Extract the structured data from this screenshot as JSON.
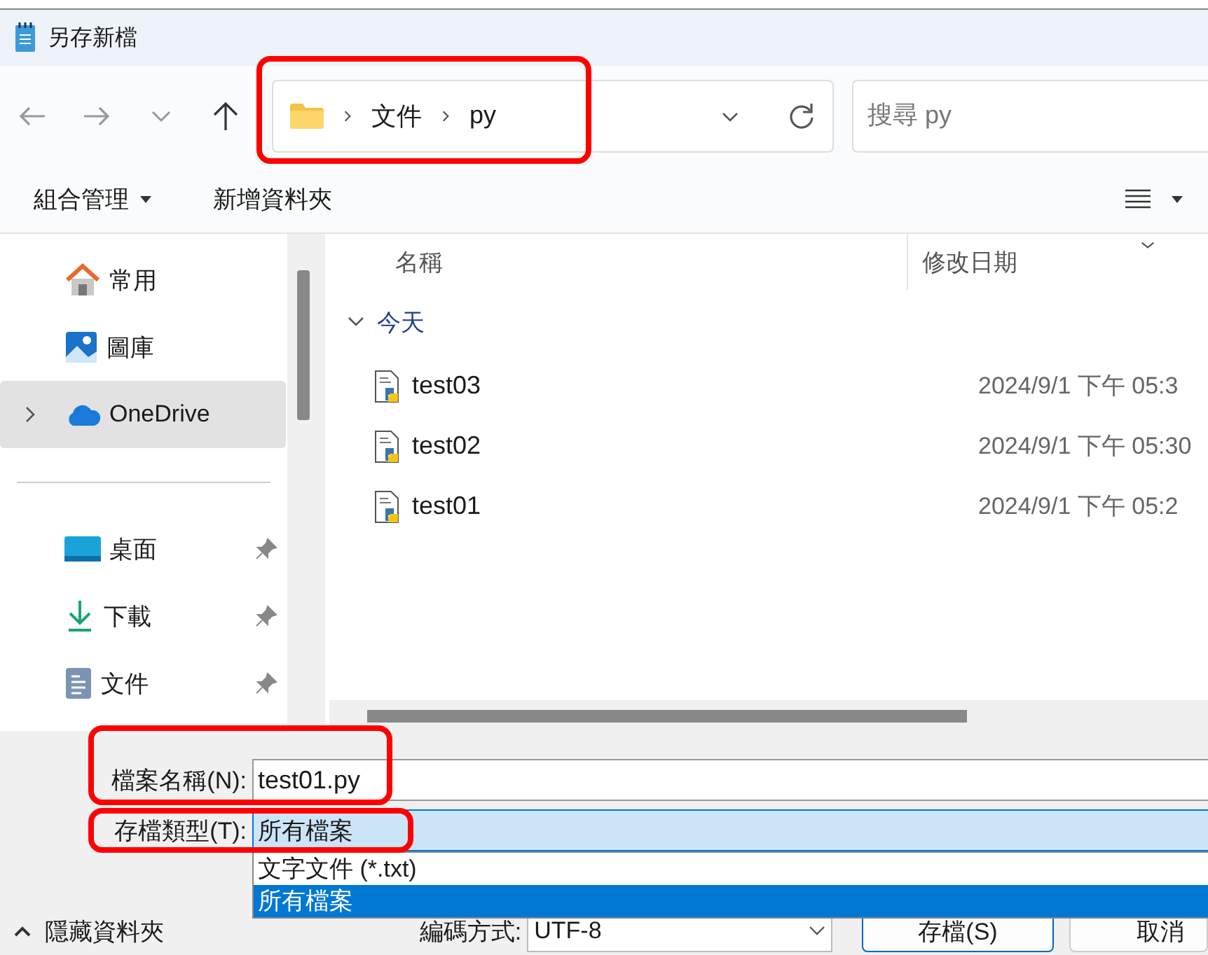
{
  "window": {
    "title": "另存新檔"
  },
  "navigation": {
    "breadcrumb": [
      "文件",
      "py"
    ],
    "search": {
      "placeholder": "搜尋 py"
    }
  },
  "toolbar": {
    "organize": "組合管理",
    "new_folder": "新增資料夾"
  },
  "sidebar": {
    "groups": [
      {
        "items": [
          {
            "label": "常用",
            "kind": "home",
            "selected": false,
            "expandable": false,
            "pinned": false
          },
          {
            "label": "圖庫",
            "kind": "gallery",
            "selected": false,
            "expandable": false,
            "pinned": false
          },
          {
            "label": "OneDrive",
            "kind": "cloud",
            "selected": true,
            "expandable": true,
            "pinned": false
          }
        ]
      },
      {
        "items": [
          {
            "label": "桌面",
            "kind": "desktop",
            "selected": false,
            "expandable": false,
            "pinned": true
          },
          {
            "label": "下載",
            "kind": "download",
            "selected": false,
            "expandable": false,
            "pinned": true
          },
          {
            "label": "文件",
            "kind": "document",
            "selected": false,
            "expandable": false,
            "pinned": true
          }
        ]
      }
    ]
  },
  "file_list": {
    "columns": [
      "名稱",
      "修改日期"
    ],
    "groups": [
      {
        "label": "今天",
        "expanded": true,
        "files": [
          {
            "name": "test03",
            "modified": "2024/9/1 下午 05:3",
            "selected": false
          },
          {
            "name": "test02",
            "modified": "2024/9/1 下午 05:30",
            "selected": false
          },
          {
            "name": "test01",
            "modified": "2024/9/1 下午 05:2",
            "selected": false
          }
        ]
      }
    ]
  },
  "save_panel": {
    "filename_label": "檔案名稱(N):",
    "filename": "test01.py",
    "type_label": "存檔類型(T):",
    "type_value": "所有檔案",
    "type_options": [
      {
        "label": "文字文件 (*.txt)",
        "selected": false
      },
      {
        "label": "所有檔案",
        "selected": true
      }
    ]
  },
  "footer": {
    "hide_folders": "隱藏資料夾",
    "encoding_label": "編碼方式:",
    "encoding": "UTF-8",
    "buttons": [
      {
        "label": "存檔(S)",
        "kind": "primary"
      },
      {
        "label": "取消",
        "kind": "normal"
      }
    ]
  }
}
